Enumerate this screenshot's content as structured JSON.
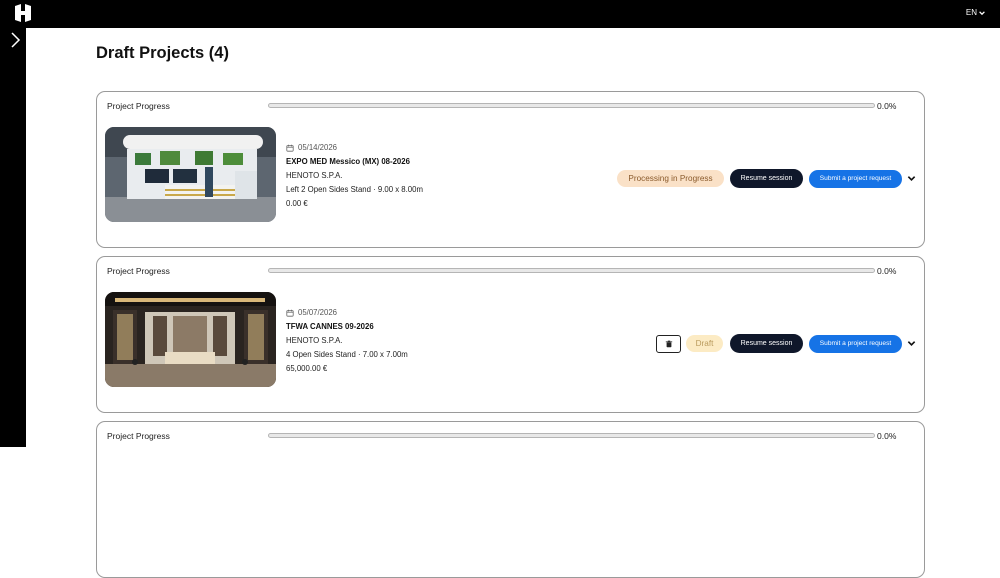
{
  "app": {
    "language": "EN"
  },
  "page": {
    "title": "Draft Projects (4)"
  },
  "cards": [
    {
      "progress_label": "Project Progress",
      "progress_value": "0.0%",
      "progress_fraction": 0.0,
      "date": "05/14/2026",
      "name": "EXPO MED Messico (MX) 08-2026",
      "company": "HENOTO S.P.A.",
      "stand": "Left 2 Open Sides Stand · 9.00 x 8.00m",
      "price": "0.00 €",
      "status": "Processing in Progress",
      "resume_label": "Resume session",
      "submit_label": "Submit a project request"
    },
    {
      "progress_label": "Project Progress",
      "progress_value": "0.0%",
      "progress_fraction": 0.0,
      "date": "05/07/2026",
      "name": "TFWA CANNES 09-2026",
      "company": "HENOTO S.P.A.",
      "stand": "4 Open Sides Stand · 7.00 x 7.00m",
      "price": "65,000.00 €",
      "status": "Draft",
      "resume_label": "Resume session",
      "submit_label": "Submit a project request"
    },
    {
      "progress_label": "Project Progress",
      "progress_value": "0.0%",
      "progress_fraction": 0.0
    }
  ]
}
